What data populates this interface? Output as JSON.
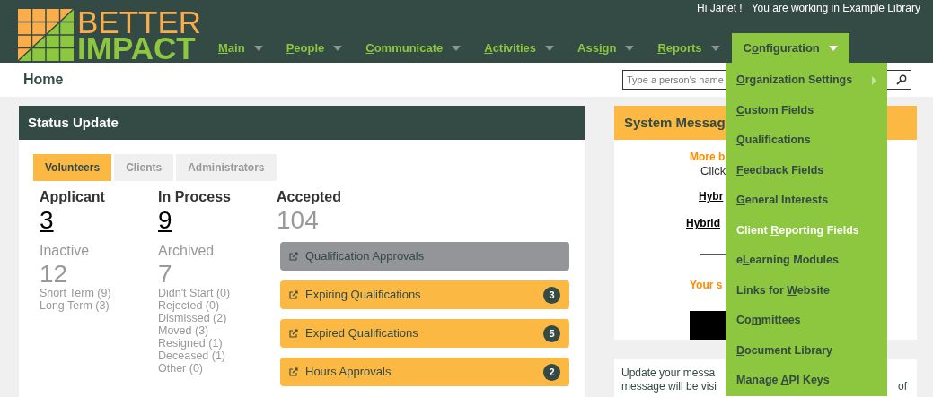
{
  "header": {
    "logo": {
      "line_1": "BETTER",
      "line_2": "IMPACT"
    },
    "user": {
      "greeting": "Hi Janet !",
      "context": "You are working in Example Library"
    },
    "nav": [
      {
        "key": "M",
        "post": "ain",
        "selected": false
      },
      {
        "key": "P",
        "post": "eople",
        "selected": false
      },
      {
        "key": "C",
        "post": "ommunicate",
        "selected": false
      },
      {
        "key": "A",
        "post": "ctivities",
        "selected": false
      },
      {
        "pre": "Ass",
        "key": "i",
        "post": "gn",
        "selected": false
      },
      {
        "key": "R",
        "post": "eports",
        "selected": false
      },
      {
        "pre": "C",
        "key": "o",
        "post": "nfiguration",
        "selected": true
      }
    ]
  },
  "page_title": "Home",
  "search": {
    "placeholder": "Type a person's name"
  },
  "dropdown": [
    {
      "key": "O",
      "post": "rganization Settings",
      "submenu": true,
      "selected": false
    },
    {
      "key": "C",
      "post": "ustom Fields",
      "submenu": false,
      "selected": false
    },
    {
      "key": "Q",
      "post": "ualifications",
      "submenu": false,
      "selected": false
    },
    {
      "key": "F",
      "post": "eedback Fields",
      "submenu": false,
      "selected": false
    },
    {
      "key": "G",
      "post": "eneral Interests",
      "submenu": false,
      "selected": false
    },
    {
      "pre": "Client ",
      "key": "R",
      "post": "eporting Fields",
      "submenu": false,
      "selected": true
    },
    {
      "pre": "e",
      "key": "L",
      "post": "earning Modules",
      "submenu": false,
      "selected": false
    },
    {
      "pre": "Links for ",
      "key": "W",
      "post": "ebsite",
      "submenu": false,
      "selected": false
    },
    {
      "pre": "Co",
      "key": "m",
      "post": "mittees",
      "submenu": false,
      "selected": false
    },
    {
      "key": "D",
      "post": "ocument Library",
      "submenu": false,
      "selected": false
    },
    {
      "pre": "Manage ",
      "key": "A",
      "post": "PI Keys",
      "submenu": false,
      "selected": false
    }
  ],
  "status_update": {
    "title": "Status Update",
    "tabs": [
      {
        "label": "Volunteers",
        "selected": true
      },
      {
        "label": "Clients",
        "selected": false
      },
      {
        "label": "Administrators",
        "selected": false
      }
    ],
    "columns": [
      {
        "heading": "Applicant",
        "count": "3",
        "linked": true,
        "sub_heading": "Inactive",
        "sub_count": "12",
        "details": [
          "Short Term (9)",
          "Long Term (3)"
        ]
      },
      {
        "heading": "In Process",
        "count": "9",
        "linked": true,
        "sub_heading": "Archived",
        "sub_count": "7",
        "details": [
          "Didn't Start (0)",
          "Rejected (0)",
          "Dismissed (2)",
          "Moved (3)",
          "Resigned (1)",
          "Deceased (1)",
          "Other (0)"
        ]
      },
      {
        "heading": "Accepted",
        "count": "104",
        "linked": false
      }
    ],
    "actions": [
      {
        "label": "Qualification Approvals",
        "disabled": true
      },
      {
        "label": "Expiring Qualifications",
        "disabled": false,
        "badge": "3"
      },
      {
        "label": "Expired Qualifications",
        "disabled": false,
        "badge": "5"
      },
      {
        "label": "Hours Approvals",
        "disabled": false,
        "badge": "2"
      }
    ]
  },
  "system_message": {
    "title": "System Messag",
    "lines": [
      {
        "kind": "highlight",
        "text": "More b"
      },
      {
        "kind": "plain",
        "text": "Click"
      },
      {
        "kind": "link",
        "text": "Hybr"
      },
      {
        "kind": "link",
        "text": "Hybrid"
      },
      {
        "kind": "rule"
      },
      {
        "kind": "highlight",
        "text": "Your s"
      },
      {
        "kind": "image"
      }
    ]
  },
  "update_note": {
    "lines": [
      {
        "left": "Update your messa"
      },
      {
        "left": "message will be visi",
        "right": "of"
      }
    ]
  }
}
